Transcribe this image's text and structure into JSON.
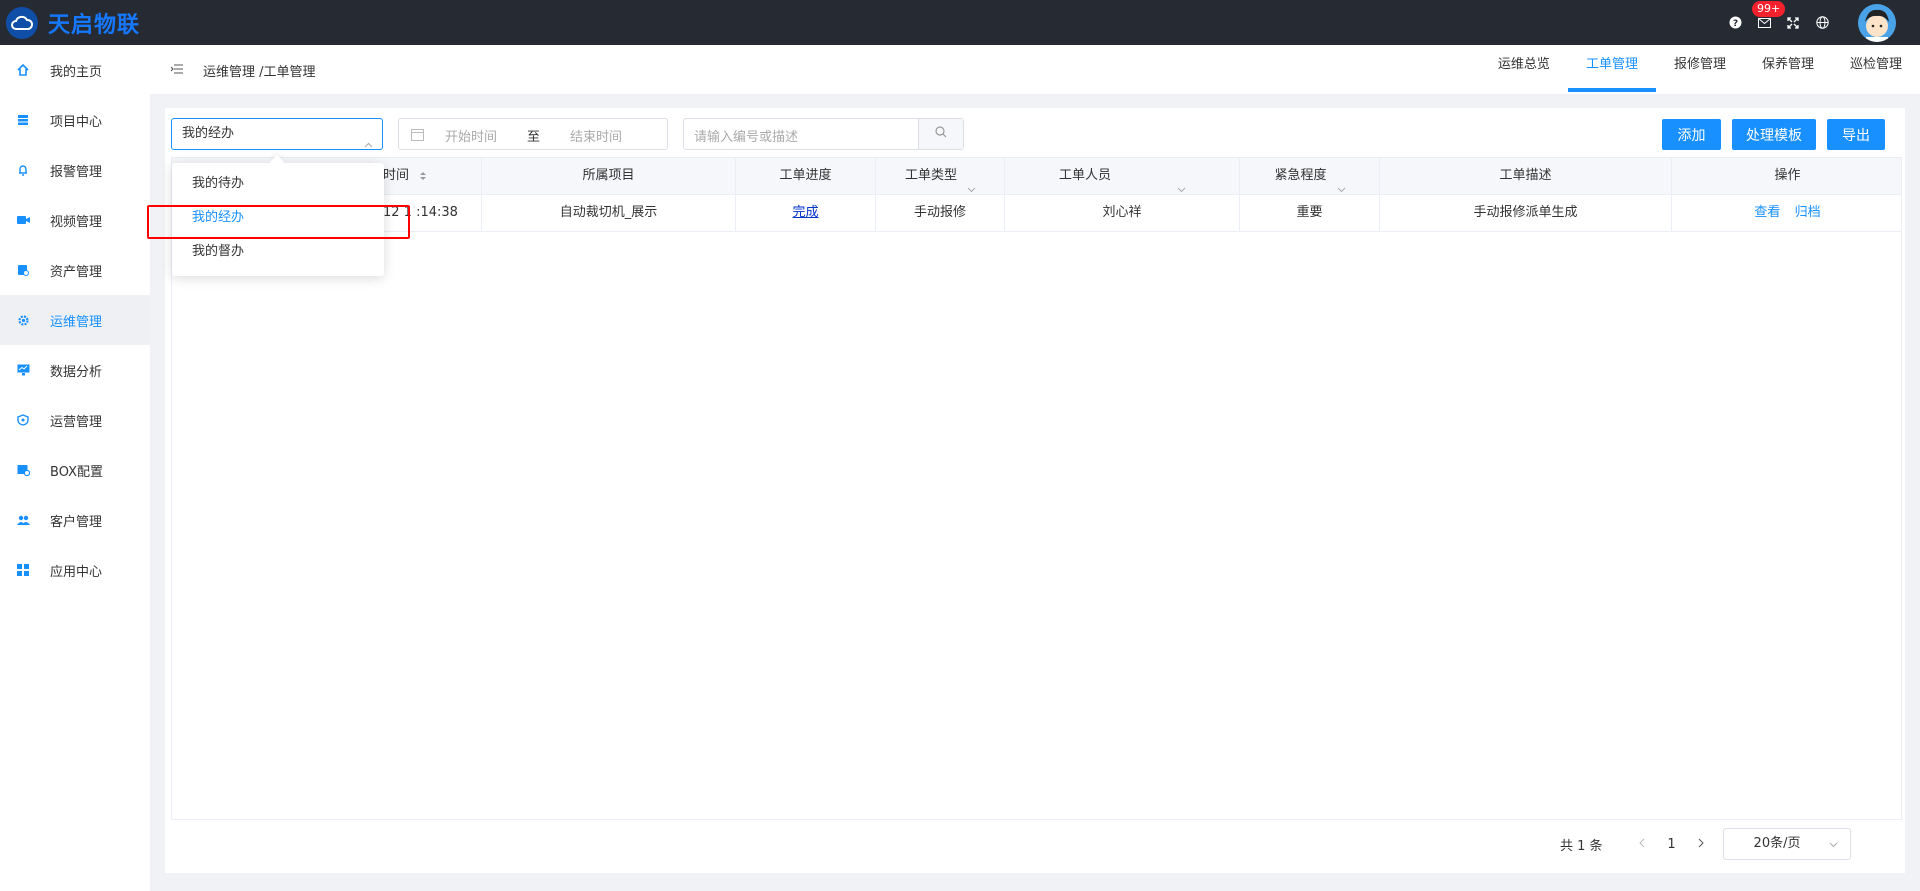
{
  "app": {
    "logo_text": "天启物联"
  },
  "topbar": {
    "badge": "99+"
  },
  "sidebar": {
    "items": [
      {
        "label": "我的主页"
      },
      {
        "label": "项目中心"
      },
      {
        "label": "报警管理"
      },
      {
        "label": "视频管理"
      },
      {
        "label": "资产管理"
      },
      {
        "label": "运维管理",
        "active": true
      },
      {
        "label": "数据分析"
      },
      {
        "label": "运营管理"
      },
      {
        "label": "BOX配置"
      },
      {
        "label": "客户管理"
      },
      {
        "label": "应用中心"
      }
    ]
  },
  "header": {
    "breadcrumb": "运维管理 /工单管理",
    "tabs": [
      {
        "label": "运维总览"
      },
      {
        "label": "工单管理",
        "active": true
      },
      {
        "label": "报修管理"
      },
      {
        "label": "保养管理"
      },
      {
        "label": "巡检管理"
      }
    ]
  },
  "filters": {
    "scope_value": "我的经办",
    "date_start_placeholder": "开始时间",
    "date_sep": "至",
    "date_end_placeholder": "结束时间",
    "search_placeholder": "请输入编号或描述"
  },
  "actions": {
    "add": "添加",
    "template": "处理模板",
    "export": "导出"
  },
  "table": {
    "columns": [
      "时间",
      "所属项目",
      "工单进度",
      "工单类型",
      "工单人员",
      "紧急程度",
      "工单描述",
      "操作"
    ],
    "rows": [
      {
        "time": "12 1 :14:38",
        "project": "自动裁切机_展示",
        "progress": "完成",
        "type": "手动报修",
        "person": "刘心祥",
        "urgency": "重要",
        "desc": "手动报修派单生成",
        "view": "查看",
        "archive": "归档"
      }
    ]
  },
  "pagination": {
    "total": "共 1 条",
    "page": "1",
    "page_size": "20条/页"
  },
  "dropdown": {
    "options": [
      {
        "label": "我的待办"
      },
      {
        "label": "我的经办",
        "selected": true
      },
      {
        "label": "我的督办"
      }
    ]
  },
  "colors": {
    "accent": "#1890ff",
    "topbar": "#252a33",
    "highlight": "#ff0000"
  }
}
